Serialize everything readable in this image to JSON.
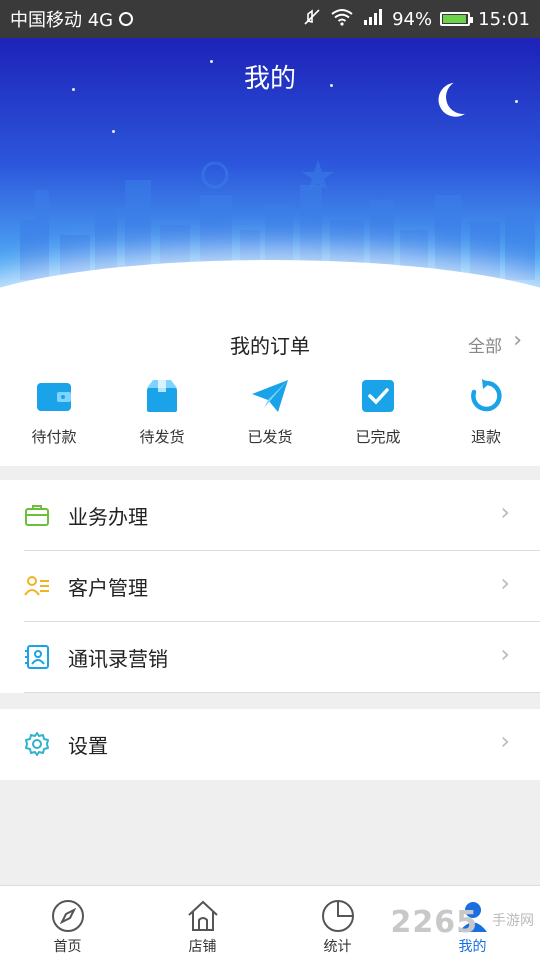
{
  "status_bar": {
    "carrier": "中国移动 4G",
    "battery": "94%",
    "battery_level": 0.94,
    "time": "15:01"
  },
  "header": {
    "title": "我的"
  },
  "orders": {
    "title": "我的订单",
    "all_label": "全部",
    "items": [
      {
        "label": "待付款",
        "icon": "wallet-icon"
      },
      {
        "label": "待发货",
        "icon": "box-icon"
      },
      {
        "label": "已发货",
        "icon": "paper-plane-icon"
      },
      {
        "label": "已完成",
        "icon": "checkbox-icon"
      },
      {
        "label": "退款",
        "icon": "refund-icon"
      }
    ]
  },
  "menu": [
    {
      "label": "业务办理",
      "icon": "briefcase-icon"
    },
    {
      "label": "客户管理",
      "icon": "customer-icon"
    },
    {
      "label": "通讯录营销",
      "icon": "contacts-icon"
    },
    {
      "label": "设置",
      "icon": "gear-icon"
    }
  ],
  "tabs": [
    {
      "label": "首页",
      "icon": "compass-icon"
    },
    {
      "label": "店铺",
      "icon": "home-icon"
    },
    {
      "label": "统计",
      "icon": "pie-chart-icon"
    },
    {
      "label": "我的",
      "icon": "user-icon",
      "active": true
    }
  ],
  "colors": {
    "accent": "#1a6fe0",
    "icon_blue": "#1aa3e8",
    "icon_green": "#6cbf3c",
    "icon_yellow": "#f0b323",
    "icon_teal": "#2fb3c9"
  },
  "watermark": {
    "text": "2265",
    "sub": "手游网"
  }
}
